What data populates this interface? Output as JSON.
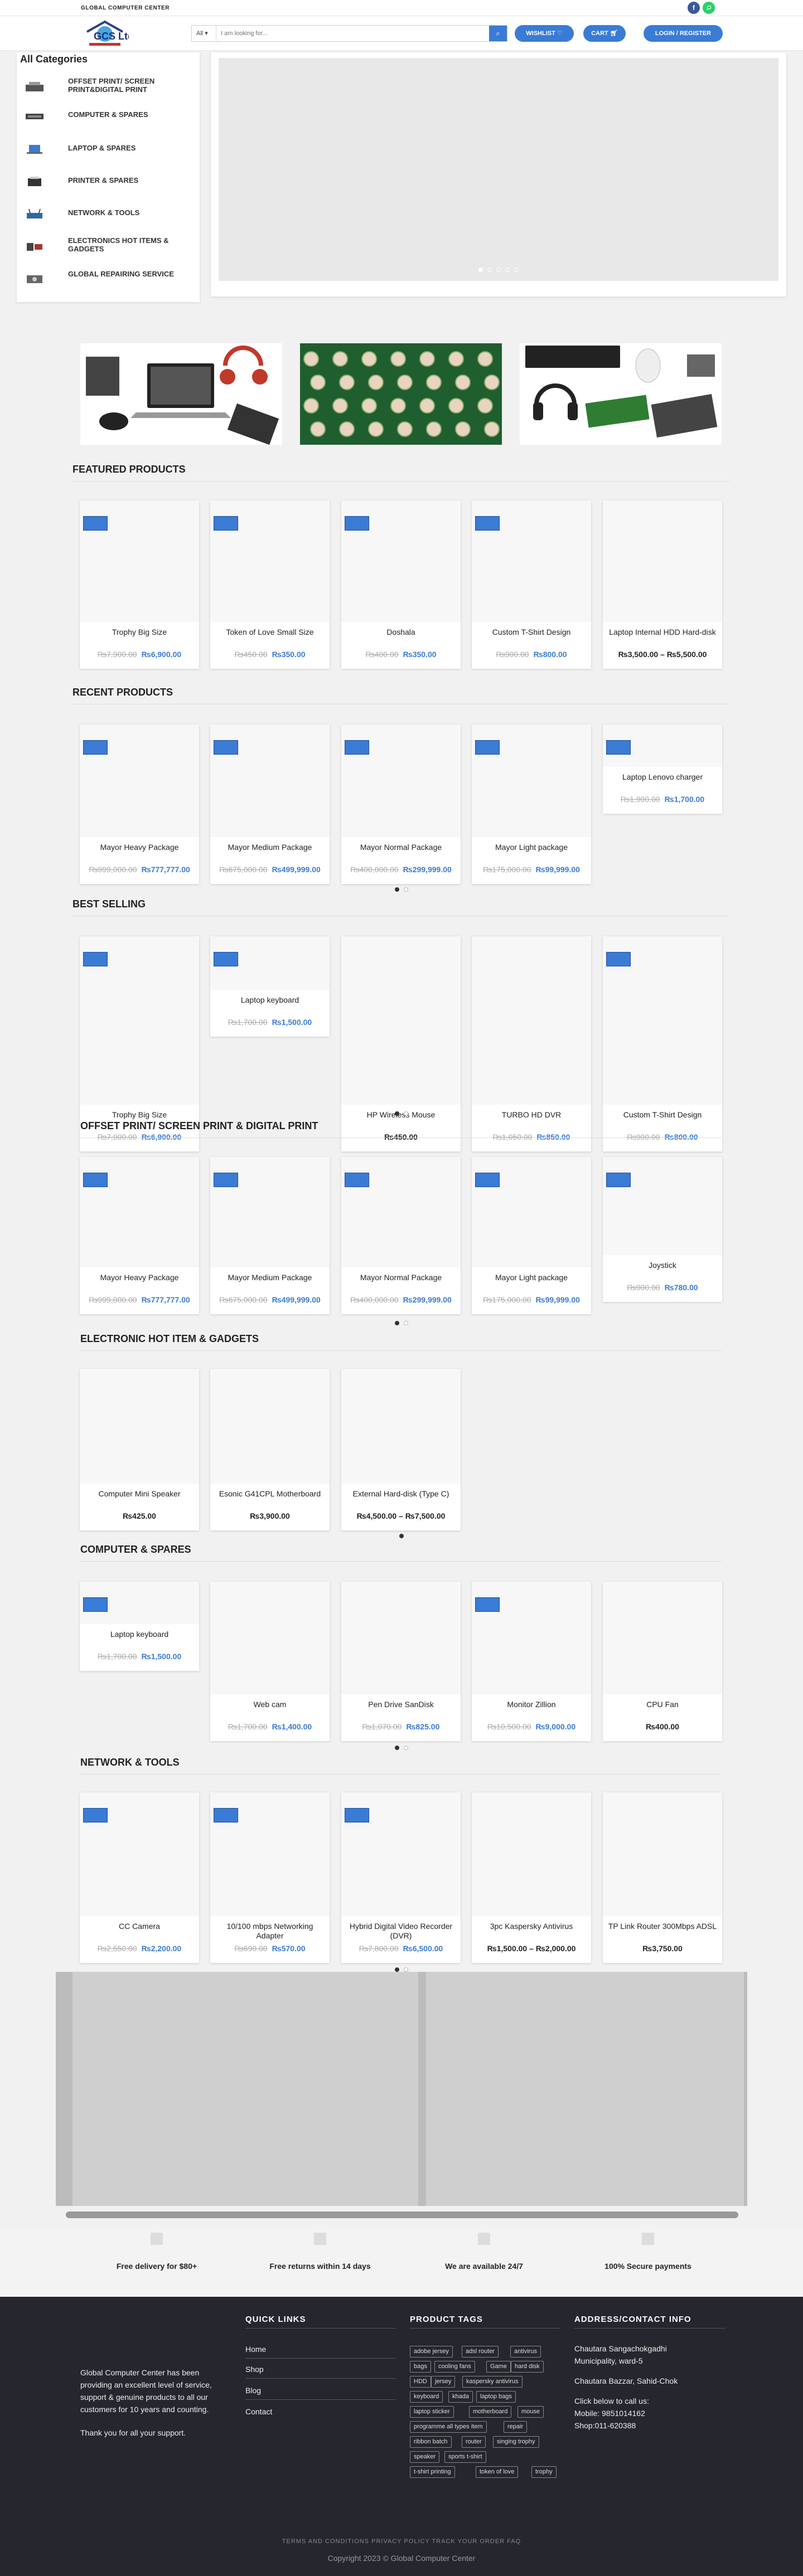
{
  "topbar": {
    "title": "GLOBAL COMPUTER CENTER",
    "facebook": "f",
    "whatsapp": "w"
  },
  "header": {
    "logo_text": "GCS Ltd",
    "search_category": "All",
    "search_placeholder": "I am looking for...",
    "wishlist": "WISHLIST",
    "cart": "CART",
    "login": "LOGIN / REGISTER"
  },
  "colors": {
    "accent": "#3a7bd5",
    "footer_bg": "#25262e",
    "facebook": "#3b5998",
    "whatsapp": "#25d366"
  },
  "sidebar": {
    "title": "All Categories",
    "items": [
      {
        "label": "OFFSET PRINT/ SCREEN PRINT&DIGITAL PRINT",
        "icon": "printer-icon"
      },
      {
        "label": "COMPUTER & SPARES",
        "icon": "keyboard-icon"
      },
      {
        "label": "LAPTOP & SPARES",
        "icon": "laptop-icon"
      },
      {
        "label": "PRINTER & SPARES",
        "icon": "printer-icon"
      },
      {
        "label": "NETWORK & TOOLS",
        "icon": "router-icon"
      },
      {
        "label": "ELECTRONICS HOT ITEMS & GADGETS",
        "icon": "gadget-icon"
      },
      {
        "label": "GLOBAL REPAIRING SERVICE",
        "icon": "tools-icon"
      }
    ]
  },
  "sections": {
    "featured": {
      "title": "FEATURED PRODUCTS",
      "products": [
        {
          "name": "Trophy Big Size",
          "old": "₨7,900.00",
          "price": "₨6,900.00"
        },
        {
          "name": "Token of Love Small Size",
          "old": "₨450.00",
          "price": "₨350.00"
        },
        {
          "name": "Doshala",
          "old": "₨400.00",
          "price": "₨350.00"
        },
        {
          "name": "Custom T-Shirt Design",
          "old": "₨900.00",
          "price": "₨800.00"
        },
        {
          "name": "Laptop Internal HDD Hard-disk",
          "old": "",
          "price": "₨3,500.00 – ₨5,500.00"
        }
      ]
    },
    "recent": {
      "title": "RECENT PRODUCTS",
      "products": [
        {
          "name": "Mayor Heavy Package",
          "old": "₨999,000.00",
          "price": "₨777,777.00"
        },
        {
          "name": "Mayor Medium Package",
          "old": "₨675,000.00",
          "price": "₨499,999.00"
        },
        {
          "name": "Mayor Normal Package",
          "old": "₨400,000.00",
          "price": "₨299,999.00"
        },
        {
          "name": "Mayor Light package",
          "old": "₨175,000.00",
          "price": "₨99,999.00"
        },
        {
          "name": "Laptop Lenovo charger",
          "old": "₨1,900.00",
          "price": "₨1,700.00"
        }
      ]
    },
    "best": {
      "title": "BEST SELLING",
      "products": [
        {
          "name": "Trophy Big Size",
          "old": "₨7,900.00",
          "price": "₨6,900.00"
        },
        {
          "name": "Laptop keyboard",
          "old": "₨1,700.00",
          "price": "₨1,500.00"
        },
        {
          "name": "HP Wireless Mouse",
          "old": "",
          "price": "₨450.00"
        },
        {
          "name": "TURBO HD DVR",
          "old": "₨1,050.00",
          "price": "₨850.00"
        },
        {
          "name": "Custom T-Shirt Design",
          "old": "₨900.00",
          "price": "₨800.00"
        }
      ]
    },
    "offset": {
      "title": "OFFSET PRINT/ SCREEN PRINT & DIGITAL PRINT",
      "products": [
        {
          "name": "Mayor Heavy Package",
          "old": "₨999,000.00",
          "price": "₨777,777.00"
        },
        {
          "name": "Mayor Medium Package",
          "old": "₨675,000.00",
          "price": "₨499,999.00"
        },
        {
          "name": "Mayor Normal Package",
          "old": "₨400,000.00",
          "price": "₨299,999.00"
        },
        {
          "name": "Mayor Light package",
          "old": "₨175,000.00",
          "price": "₨99,999.00"
        },
        {
          "name": "Joystick",
          "old": "₨900.00",
          "price": "₨780.00"
        }
      ]
    },
    "electronic": {
      "title": "ELECTRONIC HOT ITEM & GADGETS",
      "products": [
        {
          "name": "Computer Mini Speaker",
          "old": "",
          "price": "₨425.00"
        },
        {
          "name": "Esonic G41CPL Motherboard",
          "old": "",
          "price": "₨3,900.00"
        },
        {
          "name": "External Hard-disk (Type C)",
          "old": "",
          "price": "₨4,500.00 – ₨7,500.00"
        }
      ]
    },
    "computer": {
      "title": "COMPUTER & SPARES",
      "products": [
        {
          "name": "Laptop keyboard",
          "old": "₨1,700.00",
          "price": "₨1,500.00"
        },
        {
          "name": "Web cam",
          "old": "₨1,700.00",
          "price": "₨1,400.00"
        },
        {
          "name": "Pen Drive SanDisk",
          "old": "₨1,070.00",
          "price": "₨825.00"
        },
        {
          "name": "Monitor Zillion",
          "old": "₨10,500.00",
          "price": "₨9,000.00"
        },
        {
          "name": "CPU Fan",
          "old": "",
          "price": "₨400.00"
        }
      ]
    },
    "network": {
      "title": "NETWORK & TOOLS",
      "products": [
        {
          "name": "CC Camera",
          "old": "₨2,550.00",
          "price": "₨2,200.00"
        },
        {
          "name": "10/100 mbps Networking Adapter",
          "old": "₨690.00",
          "price": "₨570.00"
        },
        {
          "name": "Hybrid Digital Video Recorder (DVR)",
          "old": "₨7,800.00",
          "price": "₨6,500.00"
        },
        {
          "name": "3pc Kaspersky Antivirus",
          "old": "",
          "price": "₨1,500.00 – ₨2,000.00"
        },
        {
          "name": "TP Link Router 300Mbps ADSL",
          "old": "",
          "price": "₨3,750.00"
        }
      ]
    }
  },
  "features": [
    "Free delivery for $80+",
    "Free returns within 14 days",
    "We are available 24/7",
    "100% Secure payments"
  ],
  "footer": {
    "about": [
      "Global Computer Center has been",
      "providing an excellent level of service,",
      "support & genuine products to all our",
      "customers for 10 years and counting.",
      "",
      "Thank you for all your support."
    ],
    "quick_title": "QUICK LINKS",
    "quick_links": [
      "Home",
      "Shop",
      "Blog",
      "Contact"
    ],
    "tags_title": "PRODUCT TAGS",
    "tags": [
      "adobe jersey",
      "adsl router",
      "antivirus",
      "bags",
      "cooling fans",
      "Game",
      "hard disk",
      "HDD",
      "jersey",
      "kaspersky antivirus",
      "keyboard",
      "khada",
      "laptop bags",
      "laptop sticker",
      "motherboard",
      "mouse",
      "programme all types item",
      "repair",
      "ribbon batch",
      "router",
      "singing trophy",
      "speaker",
      "sports t-shirt",
      "t-shirt printing",
      "token of love",
      "trophy"
    ],
    "address_title": "ADDRESS/CONTACT INFO",
    "address": [
      "Chautara Sangachokgadhi",
      "Municipality, ward-5",
      "",
      "Chautara Bazzar, Sahid-Chok",
      "",
      "Click below to call us:",
      "Mobile: 9851014162",
      "Shop:011-620388"
    ],
    "bottom_links": "TERMS AND CONDITIONS    PRIVACY POLICY    TRACK YOUR ORDER    FAQ",
    "copyright": "Copyright 2023 © Global Computer Center"
  }
}
